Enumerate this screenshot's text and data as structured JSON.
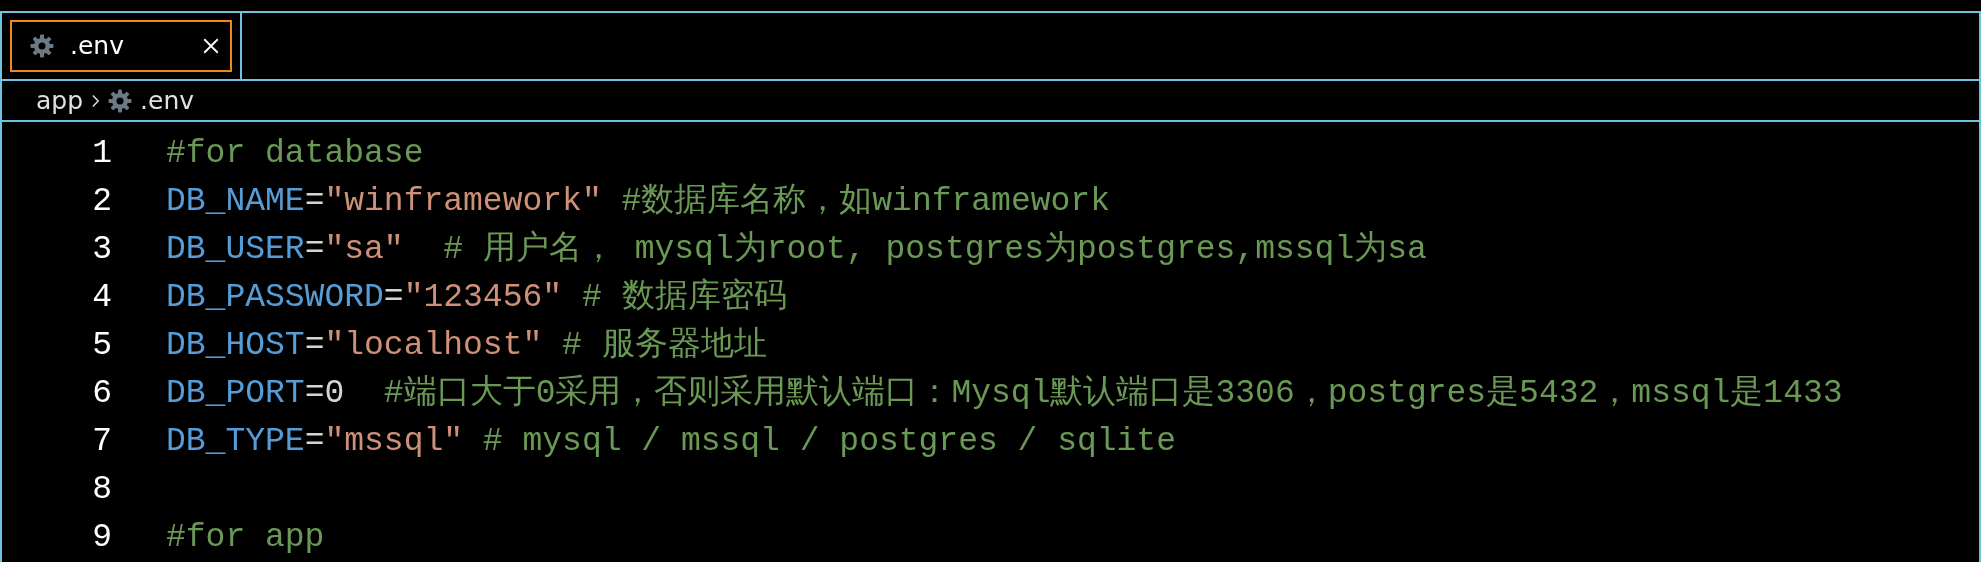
{
  "tabs": [
    {
      "label": ".env",
      "selected": true
    }
  ],
  "breadcrumb": [
    "app",
    ".env"
  ],
  "lines": [
    {
      "number": "1",
      "tokens": [
        {
          "kind": "comment",
          "text": "#for database"
        }
      ]
    },
    {
      "number": "2",
      "tokens": [
        {
          "kind": "key",
          "text": "DB_NAME"
        },
        {
          "kind": "op",
          "text": "="
        },
        {
          "kind": "string",
          "text": "\"winframework\""
        },
        {
          "kind": "comment",
          "text": " #数据库名称，如winframework"
        }
      ]
    },
    {
      "number": "3",
      "tokens": [
        {
          "kind": "key",
          "text": "DB_USER"
        },
        {
          "kind": "op",
          "text": "="
        },
        {
          "kind": "string",
          "text": "\"sa\""
        },
        {
          "kind": "comment",
          "text": "  # 用户名， mysql为root, postgres为postgres,mssql为sa"
        }
      ]
    },
    {
      "number": "4",
      "tokens": [
        {
          "kind": "key",
          "text": "DB_PASSWORD"
        },
        {
          "kind": "op",
          "text": "="
        },
        {
          "kind": "string",
          "text": "\"123456\""
        },
        {
          "kind": "comment",
          "text": " # 数据库密码"
        }
      ]
    },
    {
      "number": "5",
      "tokens": [
        {
          "kind": "key",
          "text": "DB_HOST"
        },
        {
          "kind": "op",
          "text": "="
        },
        {
          "kind": "string",
          "text": "\"localhost\""
        },
        {
          "kind": "comment",
          "text": " # 服务器地址"
        }
      ]
    },
    {
      "number": "6",
      "tokens": [
        {
          "kind": "key",
          "text": "DB_PORT"
        },
        {
          "kind": "op",
          "text": "="
        },
        {
          "kind": "number",
          "text": "0"
        },
        {
          "kind": "comment",
          "text": "  #端口大于0采用，否则采用默认端口：Mysql默认端口是3306，postgres是5432，mssql是1433"
        }
      ]
    },
    {
      "number": "7",
      "tokens": [
        {
          "kind": "key",
          "text": "DB_TYPE"
        },
        {
          "kind": "op",
          "text": "="
        },
        {
          "kind": "string",
          "text": "\"mssql\""
        },
        {
          "kind": "comment",
          "text": " # mysql / mssql / postgres / sqlite"
        }
      ]
    },
    {
      "number": "8"
    },
    {
      "number": "9",
      "tokens": [
        {
          "kind": "comment",
          "text": "#for app"
        }
      ]
    }
  ]
}
